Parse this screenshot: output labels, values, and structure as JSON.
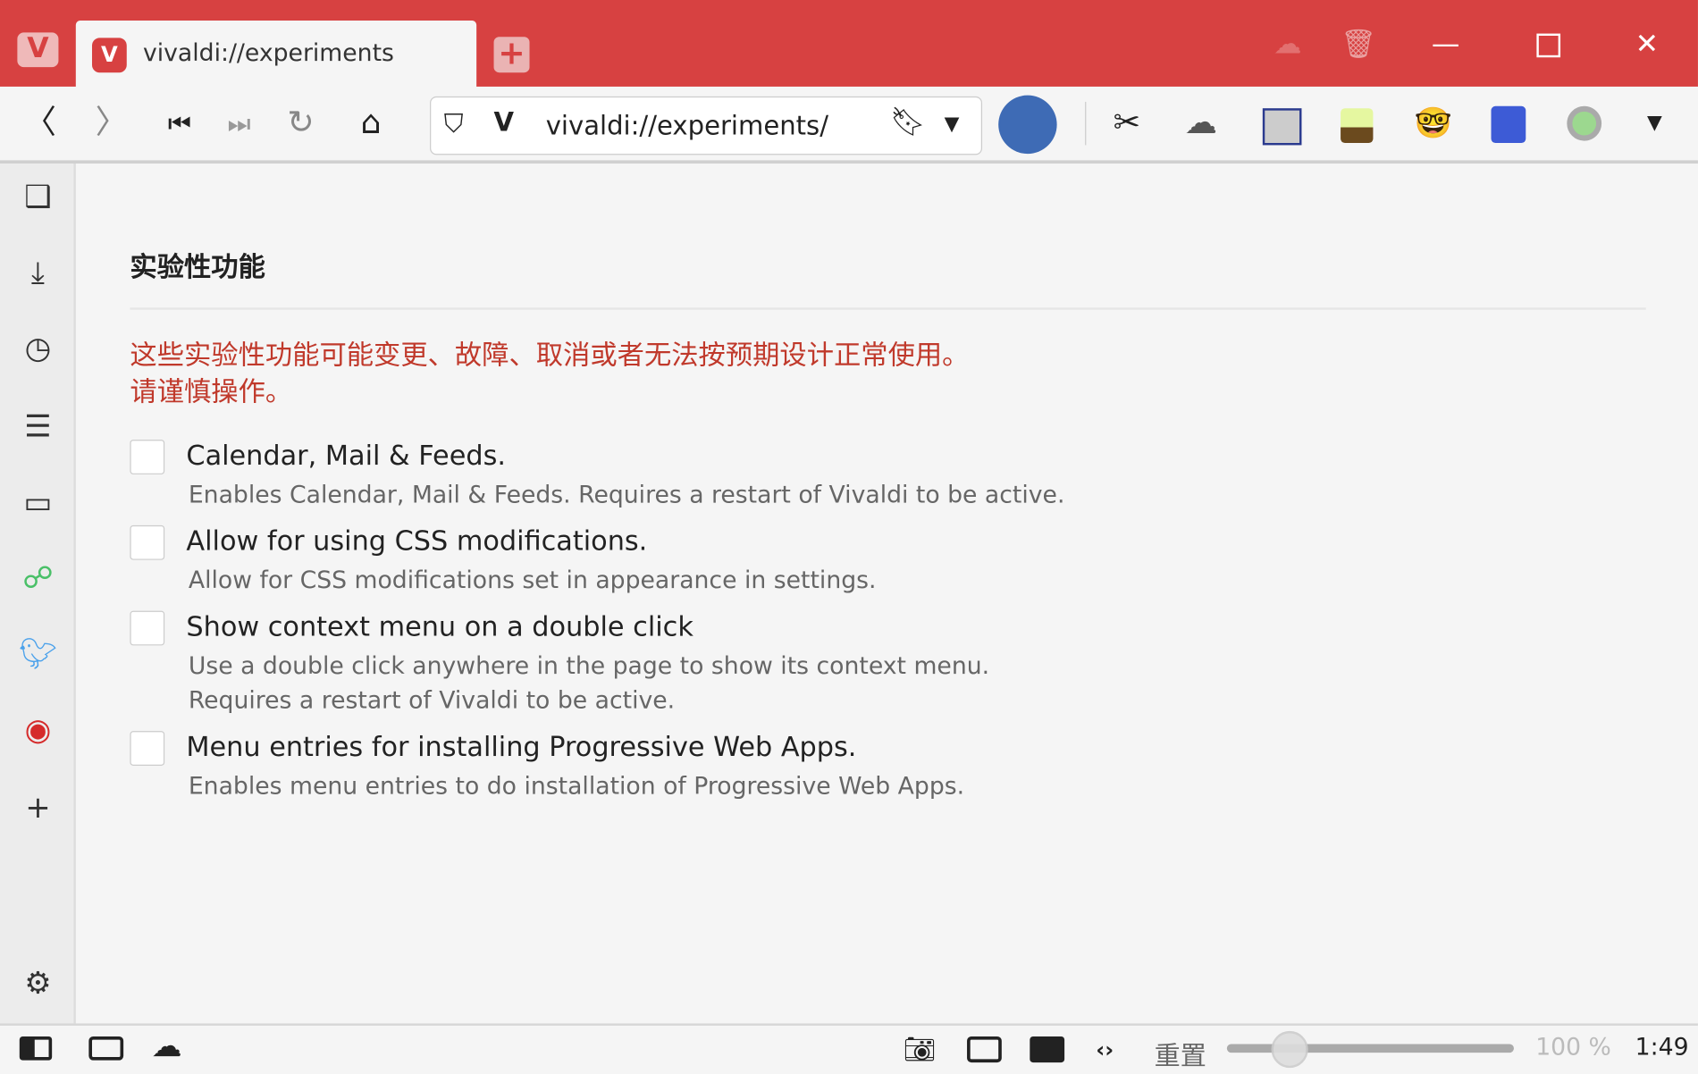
{
  "tab": {
    "title": "vivaldi://experiments"
  },
  "address": {
    "url": "vivaldi://experiments/"
  },
  "page": {
    "title": "实验性功能",
    "warning_line1": "这些实验性功能可能变更、故障、取消或者无法按预期设计正常使用。",
    "warning_line2": "请谨慎操作。",
    "options": [
      {
        "label": "Calendar, Mail & Feeds.",
        "desc": [
          "Enables Calendar, Mail & Feeds. Requires a restart of Vivaldi to be active."
        ],
        "checked": false
      },
      {
        "label": "Allow for using CSS modifications.",
        "desc": [
          "Allow for CSS modifications set in appearance in settings."
        ],
        "checked": false
      },
      {
        "label": "Show context menu on a double click",
        "desc": [
          "Use a double click anywhere in the page to show its context menu.",
          "Requires a restart of Vivaldi to be active."
        ],
        "checked": false
      },
      {
        "label": "Menu entries for installing Progressive Web Apps.",
        "desc": [
          "Enables menu entries to do installation of Progressive Web Apps."
        ],
        "checked": false
      }
    ]
  },
  "status": {
    "reset": "重置",
    "zoom": "100 %",
    "zoom_level": 0.2,
    "clock": "1:49"
  },
  "colors": {
    "accent": "#d74141",
    "warning": "#c0392b"
  }
}
